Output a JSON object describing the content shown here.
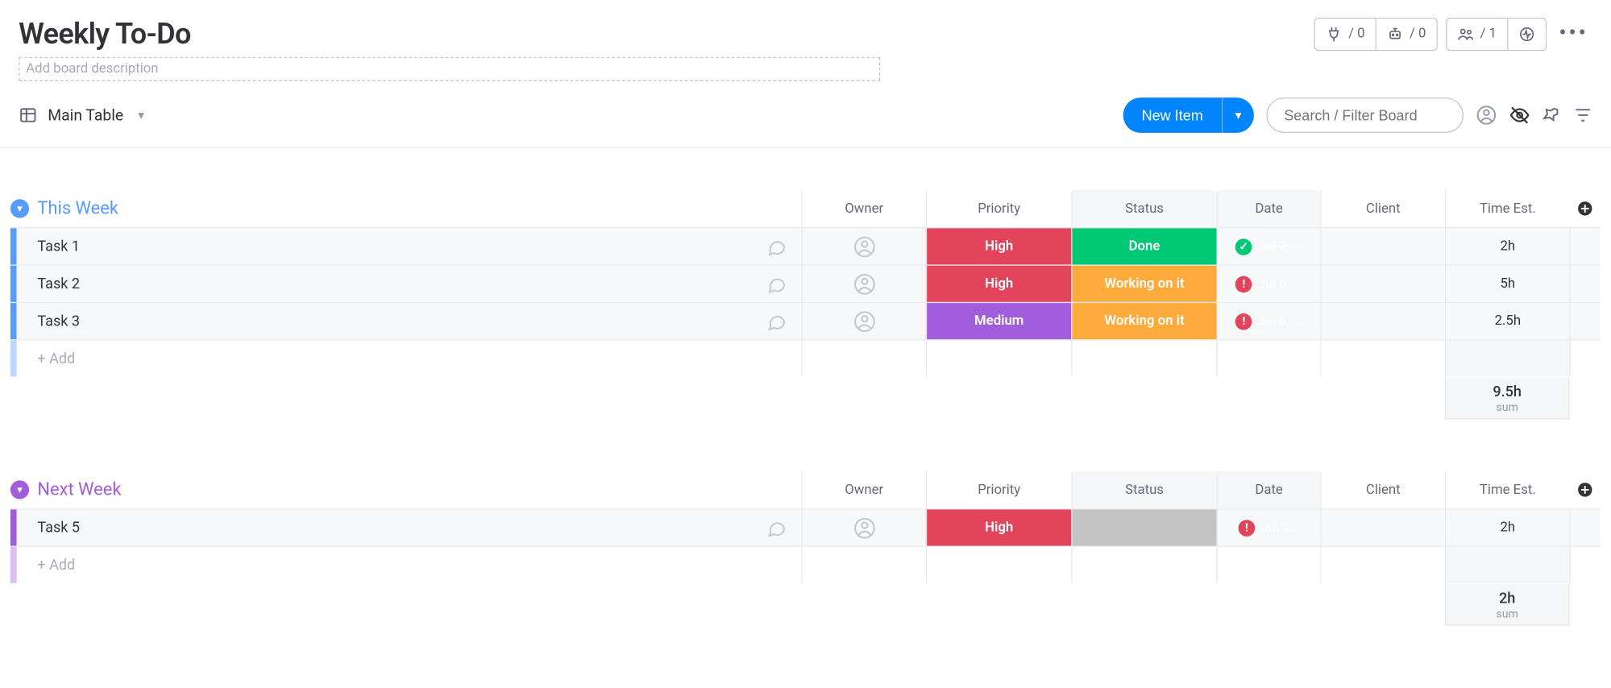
{
  "board": {
    "title": "Weekly To-Do",
    "description_placeholder": "Add board description"
  },
  "header_pills": {
    "integrations_count": "/ 0",
    "automations_count": "/ 0",
    "members_count": "/ 1"
  },
  "toolbar": {
    "view_name": "Main Table",
    "new_item": "New Item",
    "search_placeholder": "Search / Filter Board"
  },
  "columns": {
    "owner": "Owner",
    "priority": "Priority",
    "status": "Status",
    "date": "Date",
    "client": "Client",
    "time": "Time Est."
  },
  "colors": {
    "group_this_week": "#579bfc",
    "group_next_week": "#a25ddc",
    "priority_high": "#e2445c",
    "priority_medium": "#a25ddc",
    "status_done": "#00c875",
    "status_working": "#fdab3d",
    "status_blank": "#c4c4c4",
    "date_done_badge": "#00c875",
    "date_overdue_badge": "#e2445c"
  },
  "groups": [
    {
      "id": "this_week",
      "title": "This Week",
      "color": "#579bfc",
      "sum": "9.5h",
      "sum_label": "sum",
      "rows": [
        {
          "name": "Task 1",
          "priority": {
            "label": "High",
            "color": "#e2445c"
          },
          "status": {
            "label": "Done",
            "color": "#00c875"
          },
          "date": {
            "text": "Jul 2, ...",
            "strike": true,
            "badge_color": "#00c875",
            "badge_glyph": "✓"
          },
          "time": "2h"
        },
        {
          "name": "Task 2",
          "priority": {
            "label": "High",
            "color": "#e2445c"
          },
          "status": {
            "label": "Working on it",
            "color": "#fdab3d"
          },
          "date": {
            "text": "Jul 6, ...",
            "strike": false,
            "badge_color": "#e2445c",
            "badge_glyph": "!"
          },
          "time": "5h"
        },
        {
          "name": "Task 3",
          "priority": {
            "label": "Medium",
            "color": "#a25ddc"
          },
          "status": {
            "label": "Working on it",
            "color": "#fdab3d"
          },
          "date": {
            "text": "Jul 8, ...",
            "strike": false,
            "badge_color": "#e2445c",
            "badge_glyph": "!"
          },
          "time": "2.5h"
        }
      ]
    },
    {
      "id": "next_week",
      "title": "Next Week",
      "color": "#a25ddc",
      "sum": "2h",
      "sum_label": "sum",
      "rows": [
        {
          "name": "Task 5",
          "priority": {
            "label": "High",
            "color": "#e2445c"
          },
          "status": {
            "label": "",
            "color": "#c4c4c4"
          },
          "date": {
            "text": "Jul 1...",
            "strike": false,
            "badge_color": "#e2445c",
            "badge_glyph": "!"
          },
          "time": "2h"
        }
      ]
    }
  ],
  "add_row_label": "+ Add"
}
